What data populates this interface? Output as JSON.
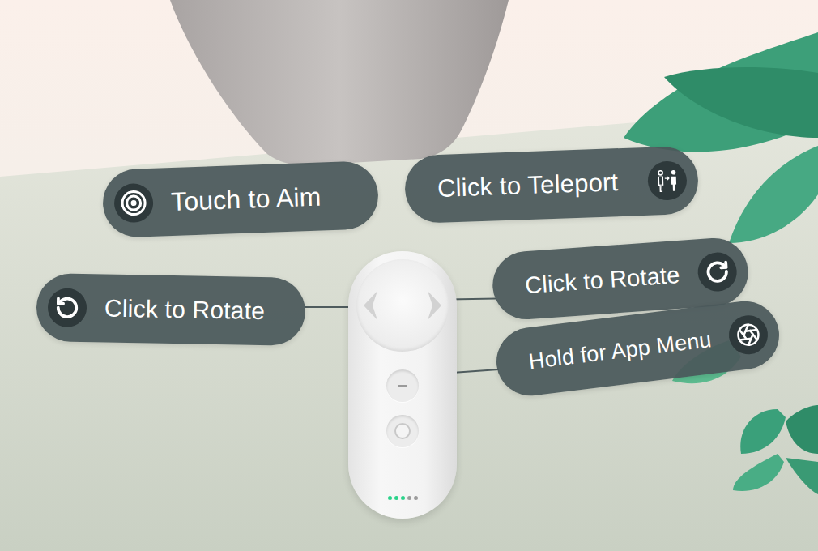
{
  "callouts": [
    {
      "label": "Touch to Aim",
      "kind": "aim"
    },
    {
      "label": "Click to Teleport",
      "kind": "teleport"
    },
    {
      "label": "Click to Rotate",
      "kind": "rotate-left"
    },
    {
      "label": "Click to Rotate",
      "kind": "rotate-right"
    },
    {
      "label": "Hold for App Menu",
      "kind": "menu"
    }
  ],
  "controller": {
    "battery": {
      "level": 0.6
    }
  }
}
